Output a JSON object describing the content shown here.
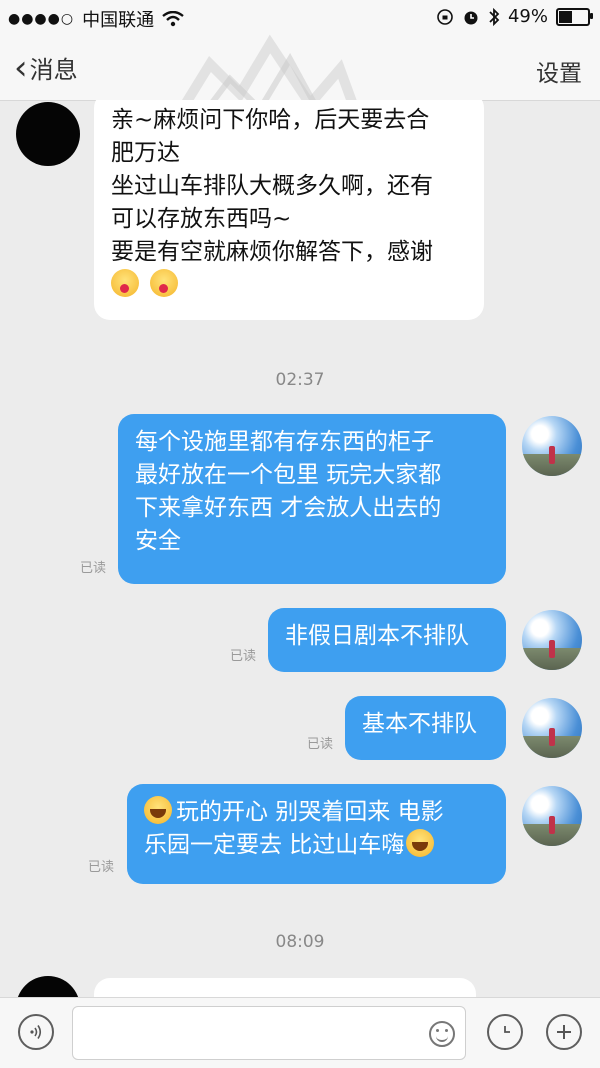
{
  "status_bar": {
    "signal": "●●●●○",
    "carrier": "中国联通",
    "battery_text": "49%",
    "battery_level": 0.49
  },
  "nav": {
    "back_label": "消息",
    "settings_label": "设置"
  },
  "messages": {
    "m1": {
      "lines": [
        "亲~麻烦问下你哈，后天要去合",
        "肥万达",
        "坐过山车排队大概多久啊，还有",
        "可以存放东西吗~",
        "要是有空就麻烦你解答下，感谢"
      ]
    },
    "time1": "02:37",
    "m2": {
      "lines": [
        "每个设施里都有存东西的柜子",
        "最好放在一个包里  玩完大家都",
        "下来拿好东西 才会放人出去的",
        "安全"
      ],
      "read": "已读"
    },
    "m3": {
      "text": "非假日剧本不排队",
      "read": "已读"
    },
    "m4": {
      "text": "基本不排队",
      "read": "已读"
    },
    "m5": {
      "line1": "玩的开心  别哭着回来  电影",
      "line2": "乐园一定要去  比过山车嗨",
      "read": "已读"
    },
    "time2": "08:09"
  },
  "input": {
    "placeholder": ""
  },
  "icons": {
    "back": "chevron-left-icon",
    "voice": "voice-icon",
    "emoji": "emoji-icon",
    "clock": "clock-icon",
    "add": "plus-icon"
  },
  "colors": {
    "outgoing_bubble": "#3e9ff0",
    "incoming_bubble": "#ffffff",
    "background": "#ececec"
  }
}
